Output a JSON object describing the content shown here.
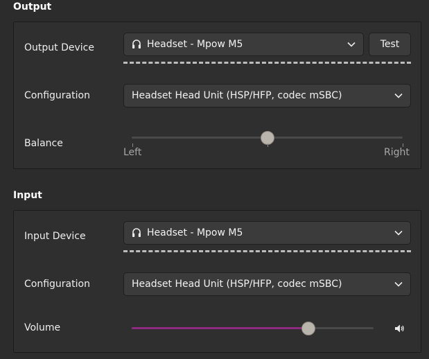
{
  "output": {
    "title": "Output",
    "device_label": "Output Device",
    "device_value": "Headset - Mpow M5",
    "test_label": "Test",
    "config_label": "Configuration",
    "config_value": "Headset Head Unit (HSP/HFP, codec mSBC)",
    "balance_label": "Balance",
    "balance_left": "Left",
    "balance_right": "Right",
    "balance_value": 0.5
  },
  "input": {
    "title": "Input",
    "device_label": "Input Device",
    "device_value": "Headset - Mpow M5",
    "config_label": "Configuration",
    "config_value": "Headset Head Unit (HSP/HFP, codec mSBC)",
    "volume_label": "Volume",
    "volume_value": 0.73
  },
  "colors": {
    "accent": "#8e2a80",
    "knob": "#b9b5ad",
    "background": "#2c2c2c"
  },
  "icons": {
    "headset": "headset-icon",
    "chevron": "chevron-down-icon",
    "speaker": "speaker-icon"
  }
}
